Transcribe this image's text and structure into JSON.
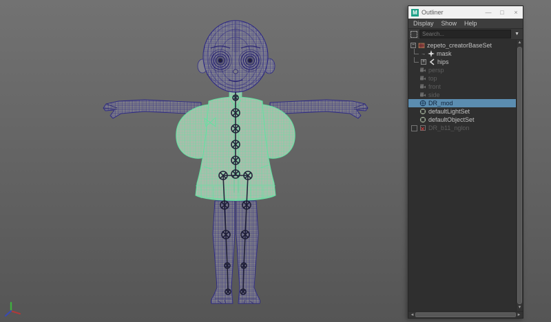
{
  "window": {
    "title": "Outliner",
    "app_badge": "M",
    "controls": {
      "minimize": "—",
      "maximize": "□",
      "close": "×"
    }
  },
  "menubar": {
    "items": [
      {
        "label": "Display"
      },
      {
        "label": "Show"
      },
      {
        "label": "Help"
      }
    ]
  },
  "search": {
    "placeholder": "Search...",
    "dropdown": "▼"
  },
  "glyphs": {
    "expanded": "−",
    "collapsed": "+",
    "in_arrow": "→"
  },
  "scrollbars": {
    "up": "▲",
    "down": "▼",
    "left": "◄",
    "right": "►"
  },
  "outliner": {
    "items": [
      {
        "label": "zepeto_creatorBaseSet",
        "state": "normal",
        "icon": "set-red",
        "expander": "expanded",
        "depth": 0
      },
      {
        "label": "mask",
        "state": "normal",
        "icon": "transform-star",
        "depth": 1
      },
      {
        "label": "hips",
        "state": "normal",
        "icon": "joint",
        "expander": "collapsed",
        "depth": 1
      },
      {
        "label": "persp",
        "state": "disabled",
        "icon": "camera",
        "depth": 0
      },
      {
        "label": "top",
        "state": "disabled",
        "icon": "camera",
        "depth": 0
      },
      {
        "label": "front",
        "state": "disabled",
        "icon": "camera",
        "depth": 0
      },
      {
        "label": "side",
        "state": "disabled",
        "icon": "camera",
        "depth": 0
      },
      {
        "label": "DR_mod",
        "state": "selected",
        "icon": "mesh",
        "depth": 0
      },
      {
        "label": "defaultLightSet",
        "state": "normal",
        "icon": "set-circle",
        "depth": 0
      },
      {
        "label": "defaultObjectSet",
        "state": "normal",
        "icon": "set-circle",
        "depth": 0
      },
      {
        "label": "DR_b11_nglon",
        "state": "disabled",
        "icon": "broken-ref",
        "depth": 0
      }
    ]
  },
  "viewport": {
    "content": "wireframe child character model in T-pose, shirt highlighted green with skeleton joints visible",
    "colors": {
      "body_wireframe": "#2e2a85",
      "garment_wireframe": "#5fe3a1",
      "skeleton": "#15152e",
      "selection_highlight": "#5b8db0",
      "maya_teal": "#1fa188",
      "axis_x": "#b03a3a",
      "axis_y": "#3fae3f",
      "axis_z": "#3a4ab0"
    }
  }
}
